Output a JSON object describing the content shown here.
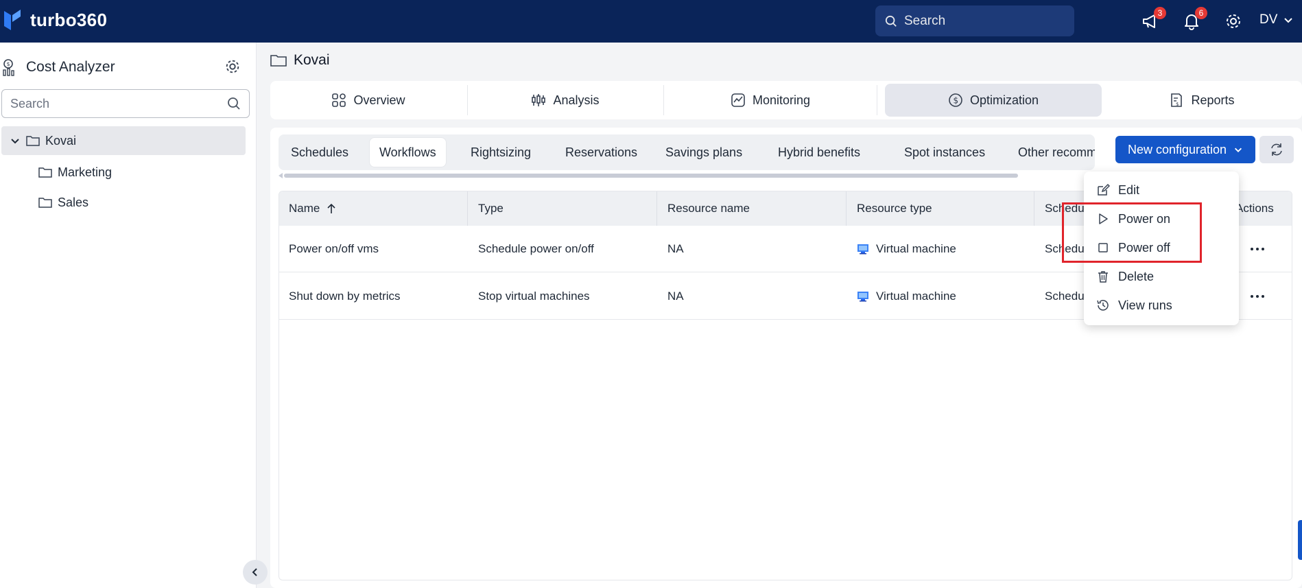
{
  "app": {
    "name": "turbo360"
  },
  "top_bar": {
    "search_placeholder": "Search",
    "announcements_count": "3",
    "notifications_count": "6",
    "user_initials": "DV"
  },
  "sidebar": {
    "title": "Cost Analyzer",
    "search_placeholder": "Search",
    "tree": [
      {
        "label": "Kovai",
        "selected": true,
        "expanded": true
      },
      {
        "label": "Marketing"
      },
      {
        "label": "Sales"
      }
    ]
  },
  "breadcrumb": {
    "label": "Kovai"
  },
  "main_tabs": [
    {
      "label": "Overview",
      "icon": "grid-icon"
    },
    {
      "label": "Analysis",
      "icon": "analysis-icon"
    },
    {
      "label": "Monitoring",
      "icon": "monitoring-icon"
    },
    {
      "label": "Optimization",
      "icon": "dollar-circle-icon",
      "active": true
    },
    {
      "label": "Reports",
      "icon": "report-icon"
    }
  ],
  "sub_tabs": [
    {
      "label": "Schedules"
    },
    {
      "label": "Workflows",
      "active": true
    },
    {
      "label": "Rightsizing"
    },
    {
      "label": "Reservations"
    },
    {
      "label": "Savings plans"
    },
    {
      "label": "Hybrid benefits"
    },
    {
      "label": "Spot instances"
    },
    {
      "label": "Other recomm"
    }
  ],
  "actions": {
    "new_configuration_label": "New configuration"
  },
  "table": {
    "columns": [
      "Name",
      "Type",
      "Resource name",
      "Resource type",
      "Schedu",
      "Actions"
    ],
    "rows": [
      {
        "name": "Power on/off vms",
        "type": "Schedule power on/off",
        "resource_name": "NA",
        "resource_type": "Virtual machine",
        "schedule": "Schedu"
      },
      {
        "name": "Shut down by metrics",
        "type": "Stop virtual machines",
        "resource_name": "NA",
        "resource_type": "Virtual machine",
        "schedule": "Schedu"
      }
    ]
  },
  "row_menu": {
    "items": [
      {
        "label": "Edit",
        "icon": "edit-icon"
      },
      {
        "label": "Power on",
        "icon": "play-icon"
      },
      {
        "label": "Power off",
        "icon": "stop-icon"
      },
      {
        "label": "Delete",
        "icon": "trash-icon"
      },
      {
        "label": "View runs",
        "icon": "history-icon"
      }
    ]
  },
  "colors": {
    "top_bar": "#0a2459",
    "primary_button": "#1456c8",
    "highlight_box": "#e0242b",
    "badge": "#e53935"
  }
}
